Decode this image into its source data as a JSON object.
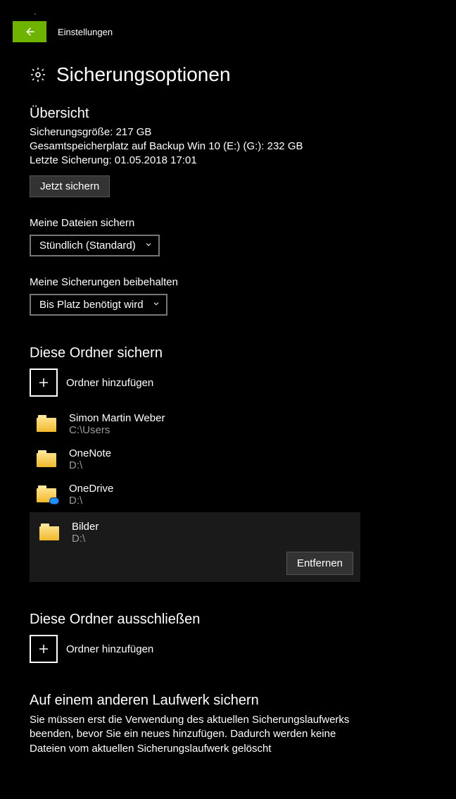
{
  "titlebar": {
    "label": "Einstellungen"
  },
  "page": {
    "title": "Sicherungsoptionen"
  },
  "overview": {
    "heading": "Übersicht",
    "size_line": "Sicherungsgröße: 217 GB",
    "total_line": "Gesamtspeicherplatz auf Backup Win 10 (E:) (G:): 232 GB",
    "last_line": "Letzte Sicherung: 01.05.2018 17:01",
    "backup_now": "Jetzt sichern"
  },
  "freq": {
    "label": "Meine Dateien sichern",
    "value": "Stündlich (Standard)"
  },
  "retain": {
    "label": "Meine Sicherungen beibehalten",
    "value": "Bis Platz benötigt wird"
  },
  "backup_folders": {
    "heading": "Diese Ordner sichern",
    "add_label": "Ordner hinzufügen",
    "items": [
      {
        "name": "Simon Martin Weber",
        "path": "C:\\Users",
        "onedrive": false
      },
      {
        "name": "OneNote",
        "path": "D:\\",
        "onedrive": false
      },
      {
        "name": "OneDrive",
        "path": "D:\\",
        "onedrive": true
      },
      {
        "name": "Bilder",
        "path": "D:\\",
        "onedrive": false
      }
    ],
    "selected_index": 3,
    "remove_label": "Entfernen"
  },
  "exclude_folders": {
    "heading": "Diese Ordner ausschließen",
    "add_label": "Ordner hinzufügen"
  },
  "other_drive": {
    "heading": "Auf einem anderen Laufwerk sichern",
    "body": "Sie müssen erst die Verwendung des aktuellen Sicherungslaufwerks beenden, bevor Sie ein neues hinzufügen. Dadurch werden keine Dateien vom aktuellen Sicherungslaufwerk gelöscht"
  }
}
